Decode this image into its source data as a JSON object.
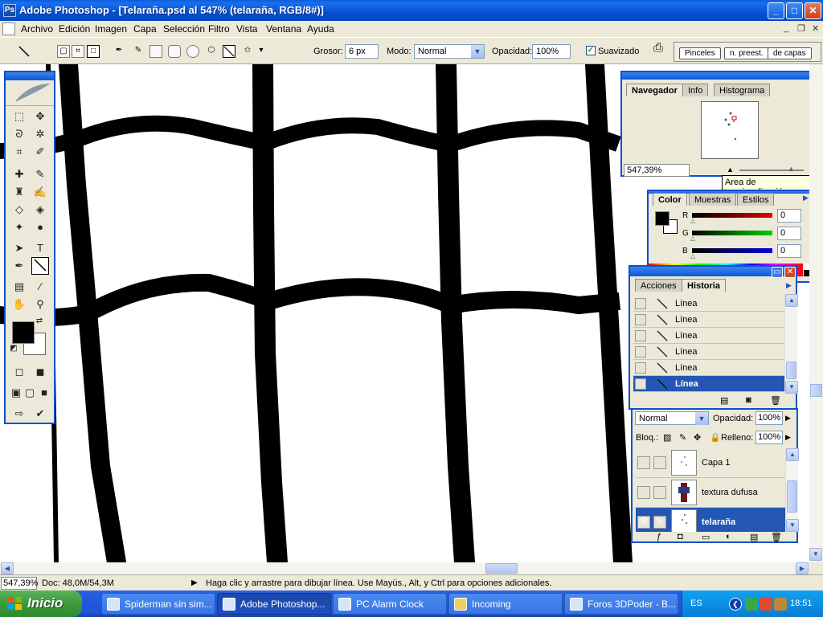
{
  "window": {
    "app": "Ps",
    "title": "Adobe Photoshop - [Telaraña.psd al 547% (telaraña, RGB/8#)]",
    "controls": {
      "minimize": "_",
      "maximize": "□",
      "close": "✕"
    }
  },
  "menu": {
    "items": [
      "Archivo",
      "Edición",
      "Imagen",
      "Capa",
      "Selección",
      "Filtro",
      "Vista",
      "Ventana",
      "Ayuda"
    ],
    "doc_controls": {
      "minimize": "_",
      "restore": "❐",
      "close": "✕"
    }
  },
  "options": {
    "grosor_label": "Grosor:",
    "grosor_value": "6 px",
    "modo_label": "Modo:",
    "modo_value": "Normal",
    "opacidad_label": "Opacidad:",
    "opacidad_value": "100%",
    "suavizado_label": "Suavizado",
    "suavizado_checked": "✓",
    "brush_tabs": [
      "Pinceles",
      "n. preest.",
      "de capas"
    ]
  },
  "navigator": {
    "tabs": [
      "Navegador",
      "Info",
      "Histograma"
    ],
    "zoom": "547,39%",
    "tooltip": "Area de previsualización"
  },
  "color": {
    "tabs": [
      "Color",
      "Muestras",
      "Estilos"
    ],
    "channels": [
      {
        "label": "R",
        "value": "0",
        "color": "#c00000"
      },
      {
        "label": "G",
        "value": "0",
        "color": "#00a000"
      },
      {
        "label": "B",
        "value": "0",
        "color": "#0000c0"
      }
    ]
  },
  "history": {
    "tabs": [
      "Acciones",
      "Historia"
    ],
    "items": [
      "Línea",
      "Línea",
      "Línea",
      "Línea",
      "Línea",
      "Línea"
    ],
    "selected_index": 5
  },
  "layers": {
    "blend": "Normal",
    "opacidad_label": "Opacidad:",
    "opacidad_value": "100%",
    "bloq_label": "Bloq.:",
    "relleno_label": "Relleno:",
    "relleno_value": "100%",
    "items": [
      "Capa 1",
      "textura dufusa",
      "telaraña"
    ],
    "selected_index": 2
  },
  "status": {
    "zoom": "547,39%",
    "doc": "Doc: 48,0M/54,3M",
    "hint": "Haga clic y arrastre para dibujar línea. Use Mayús., Alt, y Ctrl para opciones adicionales."
  },
  "taskbar": {
    "start": "Inicio",
    "tasks": [
      "Spiderman sin sim...",
      "Adobe Photoshop...",
      "PC Alarm Clock",
      "Incoming",
      "Foros 3DPoder - B..."
    ],
    "active_index": 1,
    "lang": "ES",
    "clock": "18:51"
  },
  "colors": {
    "xp_blue": "#0a5fd8",
    "selection": "#2456b4",
    "canvas_line": "#000000"
  }
}
